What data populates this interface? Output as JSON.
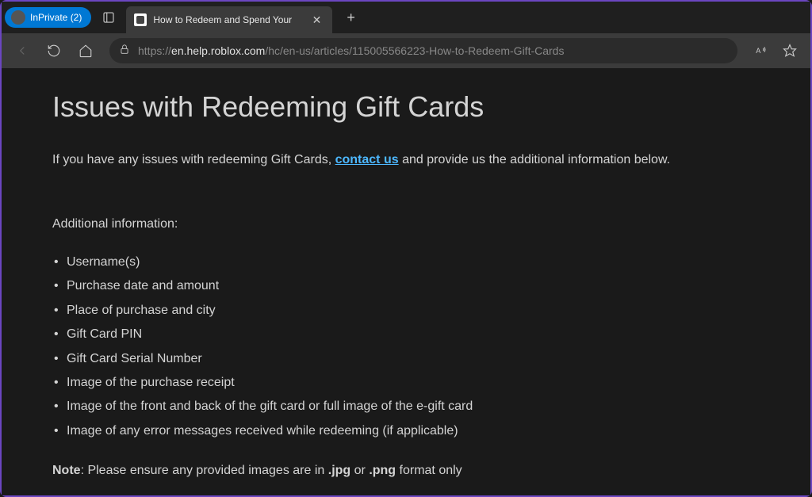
{
  "titlebar": {
    "inprivate_label": "InPrivate (2)",
    "tab_title": "How to Redeem and Spend Your"
  },
  "toolbar": {
    "url_prefix": "https://",
    "url_domain": "en.help.roblox.com",
    "url_path": "/hc/en-us/articles/115005566223-How-to-Redeem-Gift-Cards"
  },
  "page": {
    "heading": "Issues with Redeeming Gift Cards",
    "intro_before": "If you have any issues with redeeming Gift Cards, ",
    "contact_link": "contact us",
    "intro_after": " and provide us the additional information below.",
    "section_label": "Additional information:",
    "items": [
      "Username(s)",
      "Purchase date and amount",
      "Place of purchase and city",
      "Gift Card PIN",
      "Gift Card Serial Number",
      "Image of the purchase receipt",
      "Image of the front and back of the gift card or full image of the e-gift card",
      "Image of any error messages received while redeeming (if applicable)"
    ],
    "note_label": "Note",
    "note_text_1": ": Please ensure any provided images are in ",
    "note_jpg": ".jpg",
    "note_or": " or ",
    "note_png": ".png",
    "note_text_2": " format only"
  }
}
